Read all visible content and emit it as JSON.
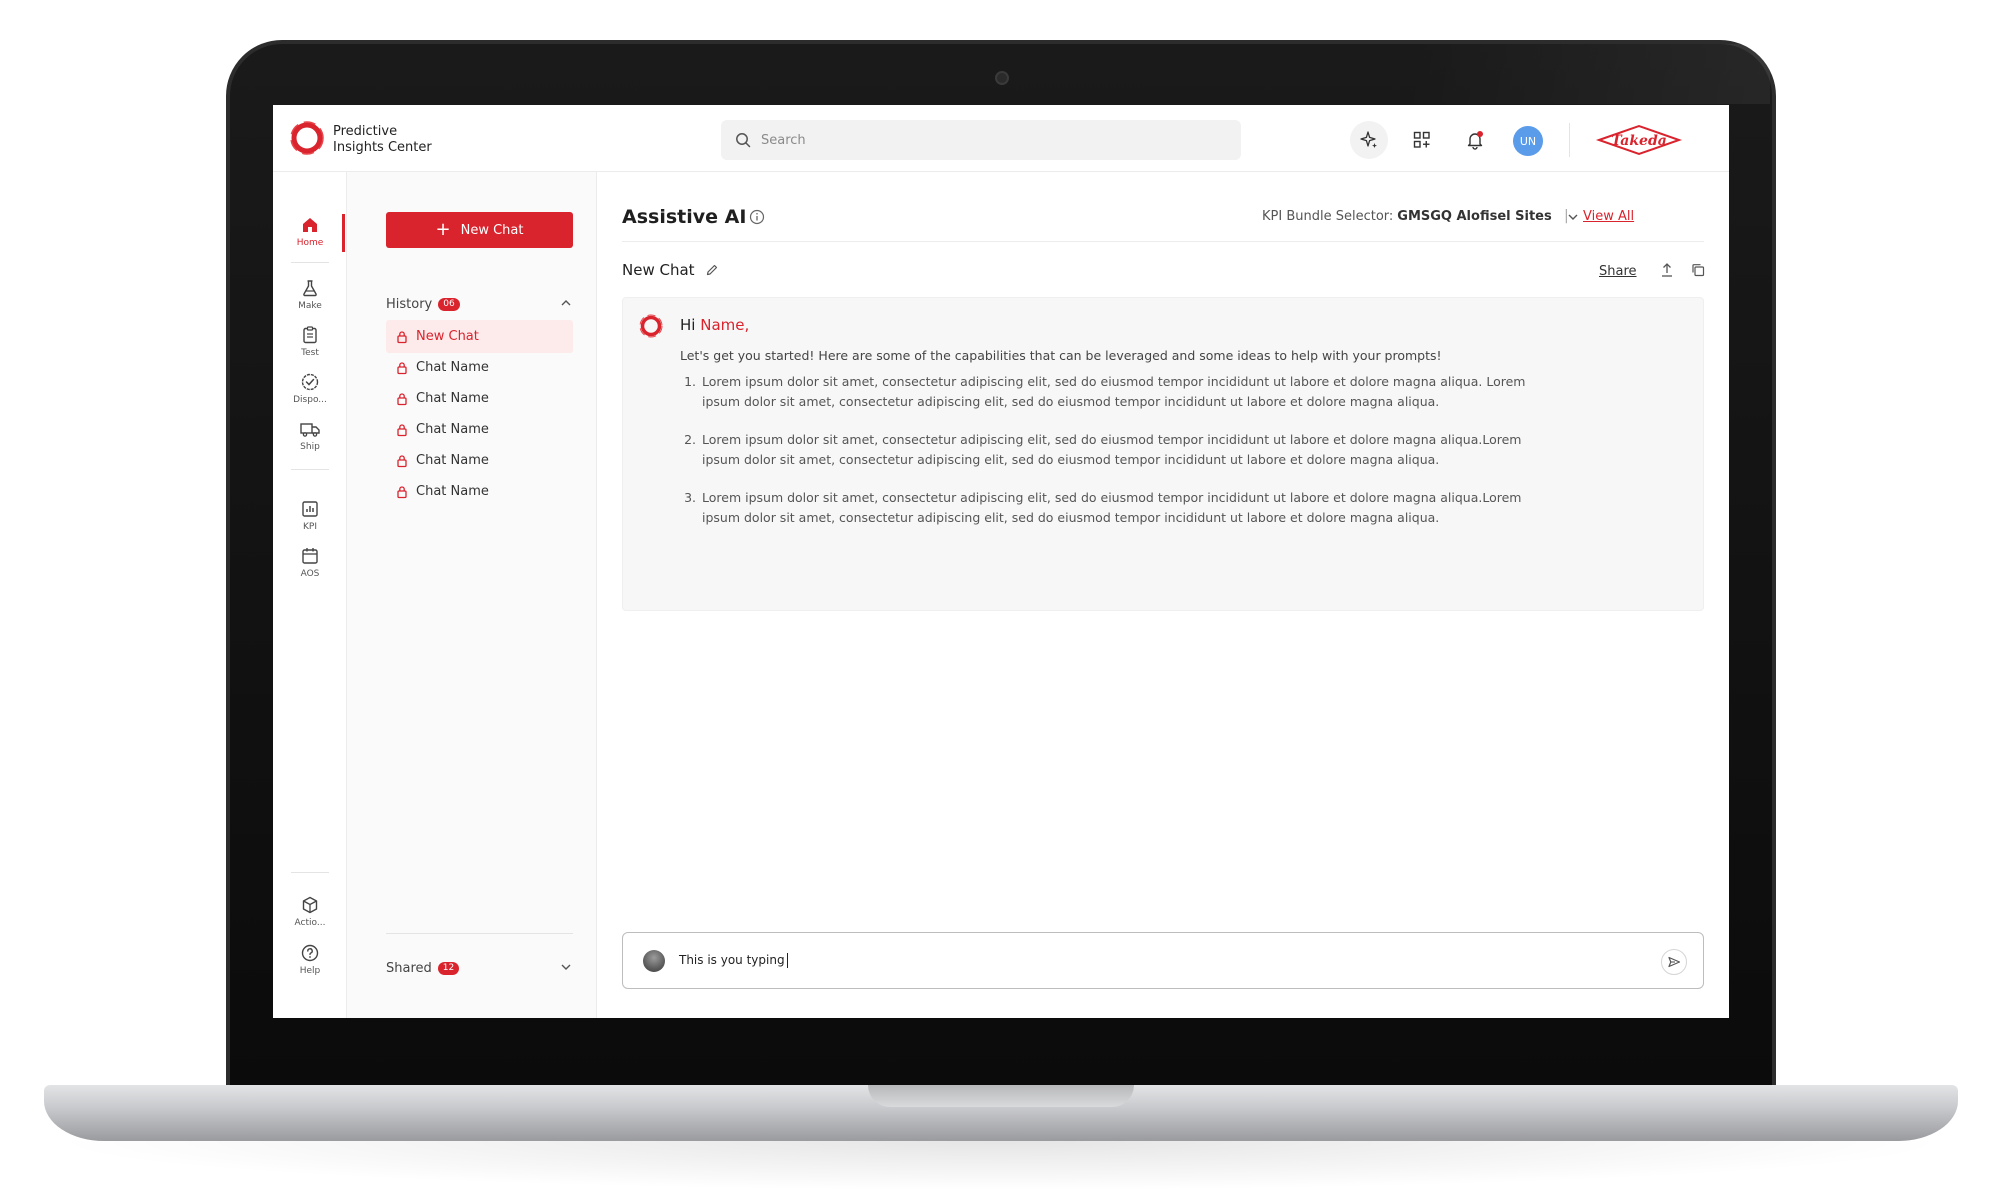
{
  "app": {
    "logo_line1": "Predictive",
    "logo_line2": "Insights Center",
    "brand": "Takeda"
  },
  "search": {
    "placeholder": "Search"
  },
  "header": {
    "user_initials": "UN"
  },
  "rail": {
    "items": [
      {
        "label": "Home",
        "icon": "home-icon",
        "active": true
      },
      {
        "label": "Make",
        "icon": "flask-icon"
      },
      {
        "label": "Test",
        "icon": "clipboard-icon"
      },
      {
        "label": "Dispo...",
        "icon": "badge-check-icon"
      },
      {
        "label": "Ship",
        "icon": "truck-icon"
      },
      {
        "label": "KPI",
        "icon": "bar-chart-icon"
      },
      {
        "label": "AOS",
        "icon": "calendar-icon"
      },
      {
        "label": "Actio...",
        "icon": "cube-icon"
      },
      {
        "label": "Help",
        "icon": "help-icon"
      }
    ]
  },
  "sidebar": {
    "new_chat_label": "New Chat",
    "history_label": "History",
    "history_count": "06",
    "history_items": [
      {
        "label": "New Chat",
        "active": true
      },
      {
        "label": "Chat Name"
      },
      {
        "label": "Chat Name"
      },
      {
        "label": "Chat Name"
      },
      {
        "label": "Chat Name"
      },
      {
        "label": "Chat Name"
      }
    ],
    "shared_label": "Shared",
    "shared_count": "12"
  },
  "main": {
    "title": "Assistive AI",
    "kpi_selector_label": "KPI Bundle Selector:",
    "kpi_selector_value": "GMSGQ Alofisel Sites",
    "view_all_label": "View All",
    "chat_title": "New Chat",
    "share_label": "Share"
  },
  "welcome": {
    "greeting": "Hi",
    "name": "Name,",
    "intro": "Let's get you started! Here are some of the capabilities that can be leveraged and some ideas to help with your prompts!",
    "capabilities": [
      {
        "num": "1.",
        "text": "Lorem ipsum dolor sit amet, consectetur adipiscing elit, sed do eiusmod tempor incididunt ut labore et dolore magna aliqua. Lorem ipsum dolor sit amet, consectetur adipiscing elit, sed do eiusmod tempor incididunt ut labore et dolore magna aliqua."
      },
      {
        "num": "2.",
        "text": "Lorem ipsum dolor sit amet, consectetur adipiscing elit, sed do eiusmod tempor incididunt ut labore et dolore magna aliqua.Lorem ipsum dolor sit amet, consectetur adipiscing elit, sed do eiusmod tempor incididunt ut labore et dolore magna aliqua."
      },
      {
        "num": "3.",
        "text": "Lorem ipsum dolor sit amet, consectetur adipiscing elit, sed do eiusmod tempor incididunt ut labore et dolore magna aliqua.Lorem ipsum dolor sit amet, consectetur adipiscing elit, sed do eiusmod tempor incididunt ut labore et dolore magna aliqua."
      }
    ]
  },
  "composer": {
    "value": "This is you typing"
  },
  "colors": {
    "accent": "#d9232d",
    "avatar": "#5a9bea"
  }
}
